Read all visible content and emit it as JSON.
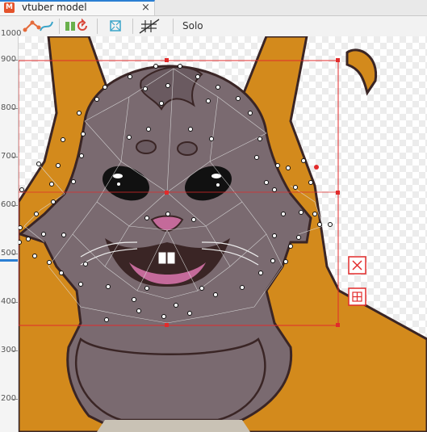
{
  "tab": {
    "title": "vtuber model",
    "close": "×",
    "logo": "M"
  },
  "toolbar": {
    "solo_label": "Solo"
  },
  "ruler": {
    "labels": [
      "1000",
      "900",
      "800",
      "700",
      "600",
      "500",
      "400",
      "300",
      "200"
    ],
    "current_value": "500"
  },
  "colors": {
    "accent": "#2b7fd3",
    "fur": "#7a6a70",
    "hood": "#d38a1c",
    "outline": "#3a2525",
    "selection": "#e22b2b"
  },
  "icons": [
    "mesh-edit-icon",
    "deformer-icon",
    "rotate-icon",
    "fit-view-icon",
    "grid-icon",
    "delete-box-icon",
    "grid-box-icon"
  ]
}
